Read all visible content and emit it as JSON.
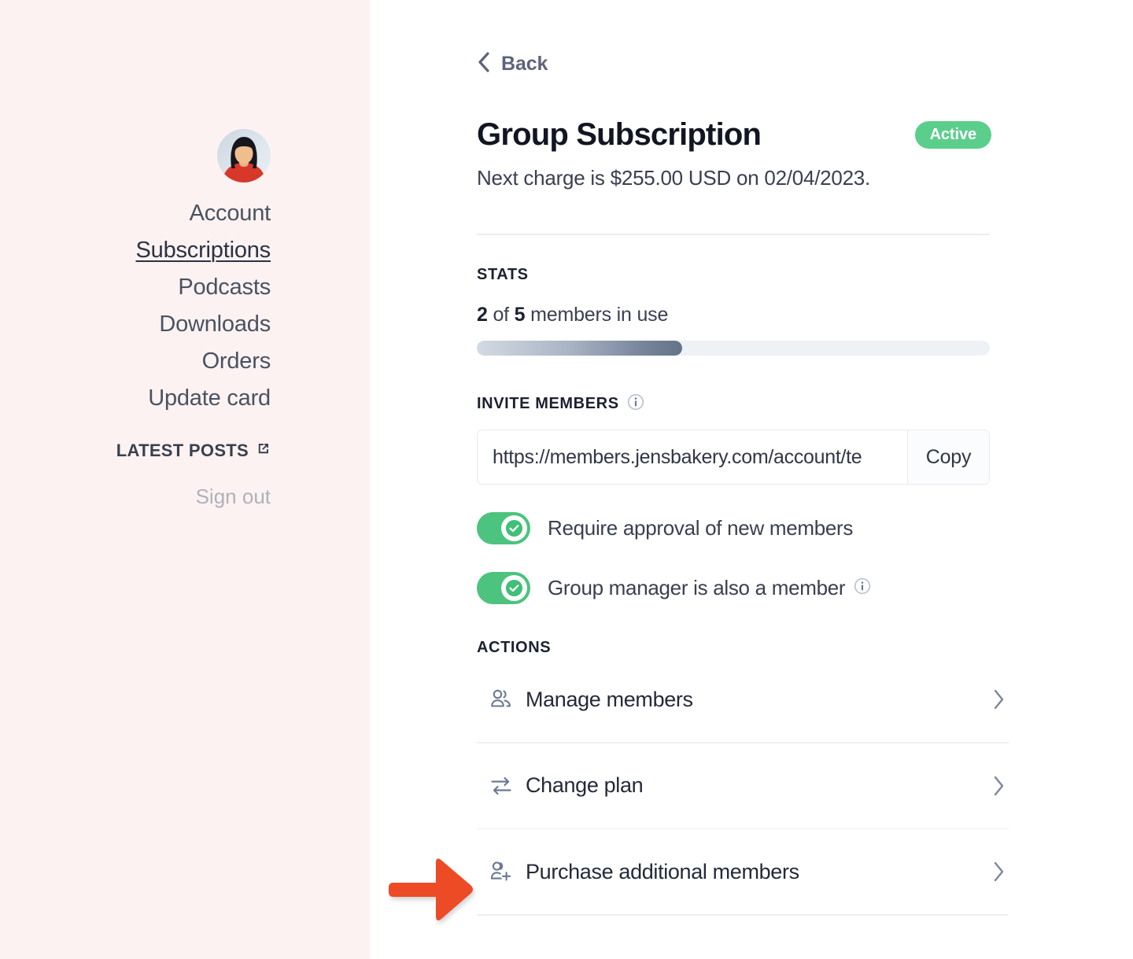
{
  "sidebar": {
    "avatar_alt": "user-avatar",
    "nav": [
      {
        "label": "Account",
        "active": false
      },
      {
        "label": "Subscriptions",
        "active": true
      },
      {
        "label": "Podcasts",
        "active": false
      },
      {
        "label": "Downloads",
        "active": false
      },
      {
        "label": "Orders",
        "active": false
      },
      {
        "label": "Update card",
        "active": false
      }
    ],
    "latest_posts_label": "LATEST POSTS",
    "sign_out_label": "Sign out",
    "background_color": "#FDF2F2"
  },
  "main": {
    "back_label": "Back",
    "title": "Group Subscription",
    "status_badge": "Active",
    "status_badge_color": "#5BCE8B",
    "next_charge": "Next charge is $255.00 USD on 02/04/2023.",
    "stats": {
      "label": "STATS",
      "used": "2",
      "of_word": "of",
      "total": "5",
      "suffix": "members in use",
      "progress_percent": 40
    },
    "invite": {
      "label": "INVITE MEMBERS",
      "url_value": "https://members.jensbakery.com/account/te",
      "url_placeholder": "https://members.jensbakery.com/account/te",
      "copy_label": "Copy"
    },
    "toggles": [
      {
        "label": "Require approval of new members",
        "on": true,
        "has_info": false
      },
      {
        "label": "Group manager is also a member",
        "on": true,
        "has_info": true
      }
    ],
    "actions": {
      "label": "ACTIONS",
      "items": [
        {
          "label": "Manage members",
          "icon": "people-icon"
        },
        {
          "label": "Change plan",
          "icon": "swap-arrows-icon"
        },
        {
          "label": "Purchase additional members",
          "icon": "person-add-icon"
        }
      ]
    }
  },
  "annotation": {
    "arrow_color": "#EC4C25",
    "points_at": "Purchase additional members"
  }
}
